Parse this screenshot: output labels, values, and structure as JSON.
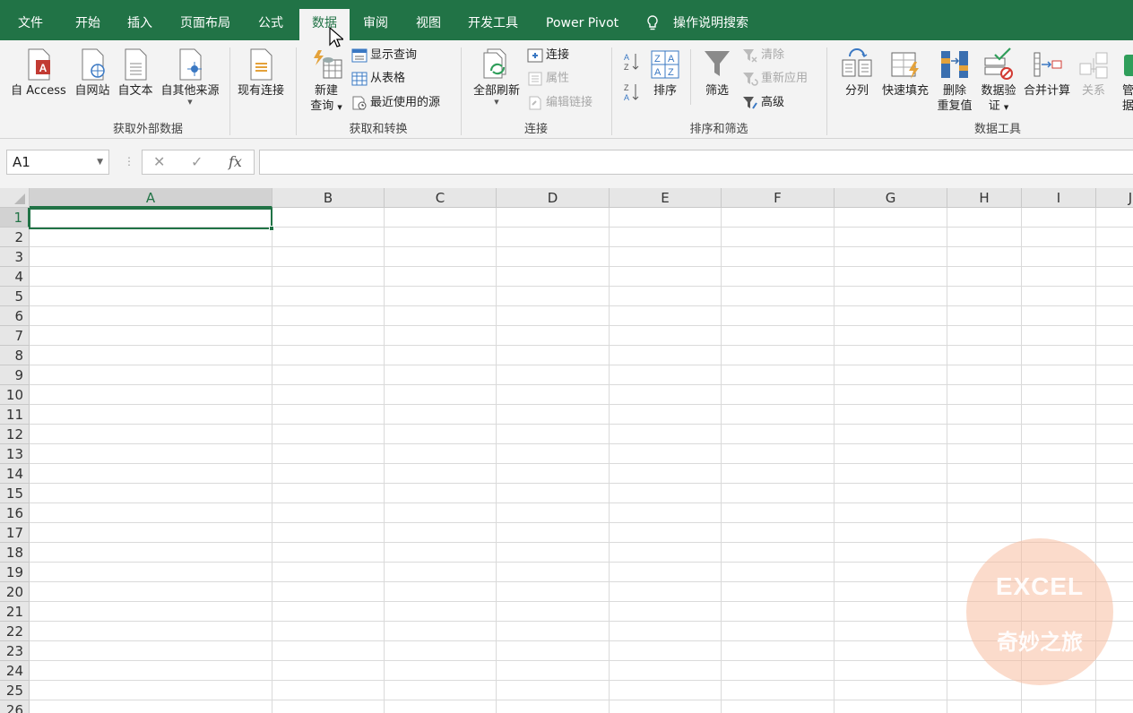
{
  "menu": {
    "tabs": [
      "文件",
      "开始",
      "插入",
      "页面布局",
      "公式",
      "数据",
      "审阅",
      "视图",
      "开发工具",
      "Power Pivot"
    ],
    "active_tab": "数据",
    "tell_me": "操作说明搜索"
  },
  "ribbon": {
    "external": {
      "label": "获取外部数据",
      "access": "自 Access",
      "web": "自网站",
      "text": "自文本",
      "other": "自其他来源",
      "existing": "现有连接"
    },
    "transform": {
      "label": "获取和转换",
      "new_query_1": "新建",
      "new_query_2": "查询",
      "show_queries": "显示查询",
      "from_table": "从表格",
      "recent_sources": "最近使用的源"
    },
    "connections": {
      "label": "连接",
      "refresh_all": "全部刷新",
      "connections": "连接",
      "properties": "属性",
      "edit_links": "编辑链接"
    },
    "sort_filter": {
      "label": "排序和筛选",
      "sort": "排序",
      "filter": "筛选",
      "clear": "清除",
      "reapply": "重新应用",
      "advanced": "高级"
    },
    "data_tools": {
      "label": "数据工具",
      "text_to_columns": "分列",
      "flash_fill": "快速填充",
      "remove_dup_1": "删除",
      "remove_dup_2": "重复值",
      "validation_1": "数据验",
      "validation_2": "证",
      "consolidate": "合并计算",
      "relationships": "关系",
      "manage_1": "管",
      "manage_2": "据"
    }
  },
  "formula_bar": {
    "name_box": "A1",
    "cancel": "✕",
    "enter": "✓",
    "fx": "fx",
    "formula": ""
  },
  "grid": {
    "columns": [
      "A",
      "B",
      "C",
      "D",
      "E",
      "F",
      "G",
      "H",
      "I",
      "J"
    ],
    "rows": [
      "1",
      "2",
      "3",
      "4",
      "5",
      "6",
      "7",
      "8",
      "9",
      "10",
      "11",
      "12",
      "13",
      "14",
      "15",
      "16",
      "17",
      "18",
      "19",
      "20",
      "21",
      "22",
      "23",
      "24",
      "25",
      "26"
    ],
    "selected_cell": "A1"
  },
  "watermark": {
    "line1": "EXCEL",
    "line2": "奇妙之旅"
  },
  "colors": {
    "brand": "#217346",
    "ribbon_bg": "#f3f3f3",
    "gridline": "#dadada"
  }
}
